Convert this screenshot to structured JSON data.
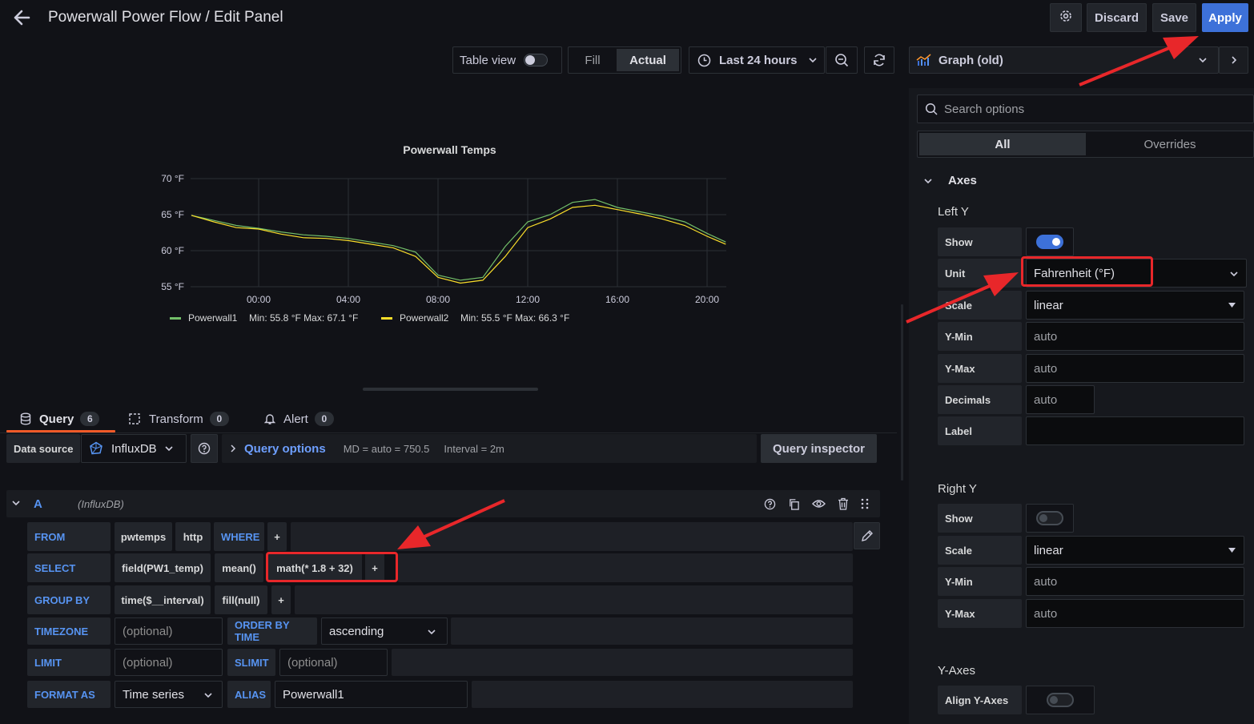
{
  "header": {
    "title": "Powerwall Power Flow / Edit Panel",
    "discard_label": "Discard",
    "save_label": "Save",
    "apply_label": "Apply"
  },
  "toolbar": {
    "table_view_label": "Table view",
    "fill_label": "Fill",
    "actual_label": "Actual",
    "time_range_label": "Last 24 hours"
  },
  "visualization": {
    "selected": "Graph (old)"
  },
  "chart_data": {
    "type": "line",
    "title": "Powerwall Temps",
    "yticks": [
      "70 °F",
      "65 °F",
      "60 °F",
      "55 °F"
    ],
    "ylim": [
      55,
      70
    ],
    "xticks": [
      "00:00",
      "04:00",
      "08:00",
      "12:00",
      "16:00",
      "20:00"
    ],
    "x": [
      "21:00",
      "22:00",
      "23:00",
      "00:00",
      "01:00",
      "02:00",
      "03:00",
      "04:00",
      "05:00",
      "06:00",
      "07:00",
      "08:00",
      "09:00",
      "10:00",
      "11:00",
      "12:00",
      "13:00",
      "14:00",
      "15:00",
      "16:00",
      "17:00",
      "18:00",
      "19:00",
      "20:00",
      "20:50"
    ],
    "series": [
      {
        "name": "Powerwall1",
        "color": "#73bf69",
        "legend_stats": "Min: 55.8 °F  Max: 67.1 °F",
        "values": [
          64.9,
          64.2,
          63.5,
          63.1,
          62.6,
          62.2,
          62.0,
          61.7,
          61.2,
          60.7,
          59.8,
          56.6,
          55.9,
          56.3,
          60.6,
          64.0,
          65.0,
          66.7,
          67.1,
          66.0,
          65.4,
          64.8,
          64.0,
          62.4,
          61.2
        ]
      },
      {
        "name": "Powerwall2",
        "color": "#fade2a",
        "legend_stats": "Min: 55.5 °F  Max: 66.3 °F",
        "values": [
          64.9,
          64.0,
          63.2,
          63.0,
          62.3,
          61.8,
          61.7,
          61.4,
          60.9,
          60.4,
          59.2,
          56.3,
          55.5,
          55.9,
          59.2,
          63.2,
          64.4,
          66.0,
          66.3,
          65.7,
          65.1,
          64.4,
          63.5,
          62.0,
          60.9
        ]
      }
    ]
  },
  "query_tabs": {
    "query_label": "Query",
    "query_count": "6",
    "transform_label": "Transform",
    "transform_count": "0",
    "alert_label": "Alert",
    "alert_count": "0"
  },
  "datasource": {
    "label": "Data source",
    "value": "InfluxDB",
    "query_options_label": "Query options",
    "md_text": "MD = auto = 750.5",
    "interval_text": "Interval = 2m",
    "query_inspector_label": "Query inspector"
  },
  "query": {
    "ref": "A",
    "ds": "(InfluxDB)",
    "from_kw": "FROM",
    "from_measurement": "pwtemps",
    "from_policy": "http",
    "where_kw": "WHERE",
    "select_kw": "SELECT",
    "select_field": "field(PW1_temp)",
    "select_mean": "mean()",
    "select_math": "math(* 1.8 + 32)",
    "groupby_kw": "GROUP BY",
    "groupby_time": "time($__interval)",
    "groupby_fill": "fill(null)",
    "timezone_kw": "TIMEZONE",
    "timezone_ph": "(optional)",
    "orderby_kw": "ORDER BY TIME",
    "orderby_val": "ascending",
    "limit_kw": "LIMIT",
    "limit_ph": "(optional)",
    "slimit_kw": "SLIMIT",
    "slimit_ph": "(optional)",
    "format_kw": "FORMAT AS",
    "format_val": "Time series",
    "alias_kw": "ALIAS",
    "alias_val": "Powerwall1",
    "plus": "+"
  },
  "options": {
    "search_placeholder": "Search options",
    "tab_all": "All",
    "tab_overrides": "Overrides",
    "axes_label": "Axes",
    "left_y": {
      "heading": "Left Y",
      "show_label": "Show",
      "show_on": true,
      "unit_label": "Unit",
      "unit_value": "Fahrenheit (°F)",
      "scale_label": "Scale",
      "scale_value": "linear",
      "ymin_label": "Y-Min",
      "ymin_value": "auto",
      "ymax_label": "Y-Max",
      "ymax_value": "auto",
      "decimals_label": "Decimals",
      "decimals_value": "auto",
      "label_label": "Label",
      "label_value": ""
    },
    "right_y": {
      "heading": "Right Y",
      "show_label": "Show",
      "show_on": false,
      "scale_label": "Scale",
      "scale_value": "linear",
      "ymin_label": "Y-Min",
      "ymin_value": "auto",
      "ymax_label": "Y-Max",
      "ymax_value": "auto"
    },
    "y_axes": {
      "heading": "Y-Axes",
      "align_label": "Align Y-Axes",
      "align_on": false
    }
  },
  "colors": {
    "accent": "#3d71d9",
    "annotation": "#e8272a",
    "tab_underline": "#f05a28"
  }
}
